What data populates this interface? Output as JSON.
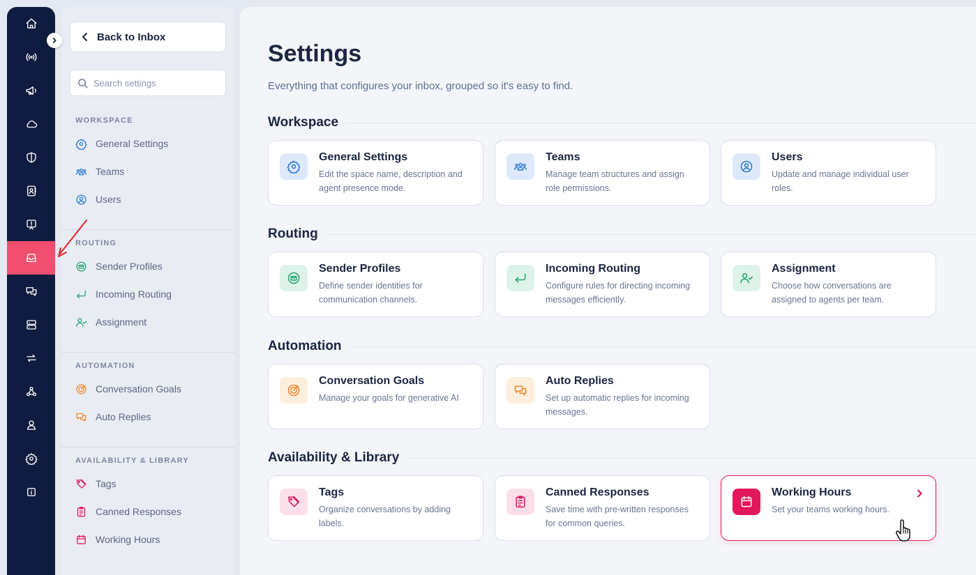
{
  "rail": {
    "items": [
      {
        "icon": "home-icon"
      },
      {
        "icon": "broadcast-icon"
      },
      {
        "icon": "megaphone-icon"
      },
      {
        "icon": "cloud-icon"
      },
      {
        "icon": "shield-icon"
      },
      {
        "icon": "contacts-icon"
      },
      {
        "icon": "report-icon"
      },
      {
        "icon": "inbox-icon",
        "active": true
      },
      {
        "icon": "chat-icon"
      },
      {
        "icon": "server-icon"
      },
      {
        "icon": "sync-icon"
      },
      {
        "icon": "webhook-icon"
      },
      {
        "icon": "user-icon"
      },
      {
        "icon": "settings-icon"
      },
      {
        "icon": "info-icon"
      }
    ],
    "active_color": "#f0506e",
    "background": "#0e1c3f"
  },
  "sidebar": {
    "back_label": "Back to Inbox",
    "search_placeholder": "Search settings",
    "groups": [
      {
        "heading": "WORKSPACE",
        "items": [
          {
            "label": "General Settings",
            "icon": "gear-icon"
          },
          {
            "label": "Teams",
            "icon": "team-icon"
          },
          {
            "label": "Users",
            "icon": "user-circle-icon"
          }
        ]
      },
      {
        "heading": "ROUTING",
        "items": [
          {
            "label": "Sender Profiles",
            "icon": "mail-badge-icon"
          },
          {
            "label": "Incoming Routing",
            "icon": "return-arrow-icon"
          },
          {
            "label": "Assignment",
            "icon": "user-check-icon"
          }
        ]
      },
      {
        "heading": "AUTOMATION",
        "items": [
          {
            "label": "Conversation Goals",
            "icon": "target-icon"
          },
          {
            "label": "Auto Replies",
            "icon": "chat-bubbles-icon"
          }
        ]
      },
      {
        "heading": "AVAILABILITY & LIBRARY",
        "items": [
          {
            "label": "Tags",
            "icon": "tag-icon"
          },
          {
            "label": "Canned Responses",
            "icon": "clipboard-icon"
          },
          {
            "label": "Working Hours",
            "icon": "calendar-icon"
          }
        ]
      }
    ]
  },
  "main": {
    "title": "Settings",
    "subtitle": "Everything that configures your inbox, grouped so it's easy to find.",
    "sections": [
      {
        "title": "Workspace",
        "cards": [
          {
            "title": "General Settings",
            "desc": "Edit the space name, description and agent presence mode.",
            "icon": "gear-icon"
          },
          {
            "title": "Teams",
            "desc": "Manage team structures and assign role permissions.",
            "icon": "team-icon"
          },
          {
            "title": "Users",
            "desc": "Update and manage individual user roles.",
            "icon": "user-circle-icon"
          }
        ]
      },
      {
        "title": "Routing",
        "cards": [
          {
            "title": "Sender Profiles",
            "desc": "Define sender identities for communication channels.",
            "icon": "mail-badge-icon"
          },
          {
            "title": "Incoming Routing",
            "desc": "Configure rules for directing incoming messages efficiently.",
            "icon": "return-arrow-icon"
          },
          {
            "title": "Assignment",
            "desc": "Choose how conversations are assigned to agents per team.",
            "icon": "user-check-icon"
          }
        ]
      },
      {
        "title": "Automation",
        "cards": [
          {
            "title": "Conversation Goals",
            "desc": "Manage your goals for generative AI",
            "icon": "target-icon"
          },
          {
            "title": "Auto Replies",
            "desc": "Set up automatic replies for incoming messages.",
            "icon": "chat-bubbles-icon"
          }
        ]
      },
      {
        "title": "Availability & Library",
        "cards": [
          {
            "title": "Tags",
            "desc": "Organize conversations by adding labels.",
            "icon": "tag-icon"
          },
          {
            "title": "Canned Responses",
            "desc": "Save time with pre-written responses for common queries.",
            "icon": "clipboard-icon"
          },
          {
            "title": "Working Hours",
            "desc": "Set your teams working hours.",
            "icon": "calendar-icon",
            "highlighted": true
          }
        ]
      }
    ]
  },
  "colors": {
    "accent": "#e2185b",
    "workspace": "#2e7bd6",
    "routing": "#20a571",
    "automation": "#ee8a30",
    "library": "#e2185b"
  }
}
